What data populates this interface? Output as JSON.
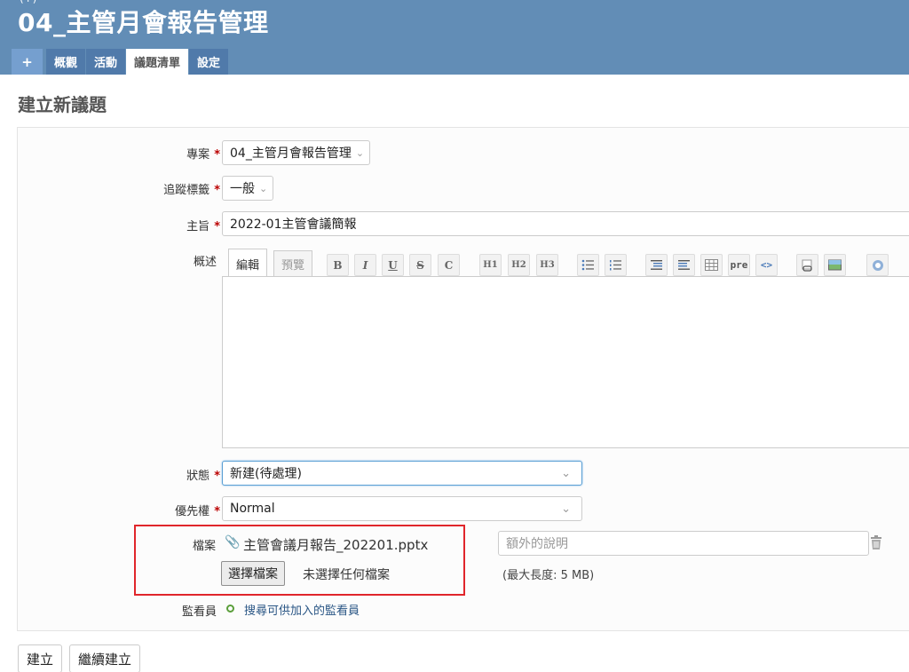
{
  "header": {
    "top_text": "(+)",
    "project_title": "04_主管月會報告管理"
  },
  "menu": {
    "plus": "+",
    "tabs": [
      "概觀",
      "活動",
      "議題清單",
      "設定"
    ],
    "selected": "議題清單"
  },
  "page": {
    "heading": "建立新議題"
  },
  "form": {
    "project": {
      "label": "專案",
      "value": "04_主管月會報告管理"
    },
    "tracker": {
      "label": "追蹤標籤",
      "value": "一般"
    },
    "subject": {
      "label": "主旨",
      "value": "2022-01主管會議簡報"
    },
    "description": {
      "label": "概述",
      "tab_edit": "編輯",
      "tab_preview": "預覽",
      "toolbar": [
        "B",
        "I",
        "U",
        "S",
        "C",
        "H1",
        "H2",
        "H3",
        "ul",
        "ol",
        "blockquote",
        "unquote",
        "table",
        "pre",
        "code",
        "link",
        "image",
        "help"
      ],
      "pre_label": "pre",
      "code_label": "<>"
    },
    "status": {
      "label": "狀態",
      "value": "新建(待處理)"
    },
    "priority": {
      "label": "優先權",
      "value": "Normal"
    },
    "files": {
      "label": "檔案",
      "attached_file": "主管會議月報告_202201.pptx",
      "description_placeholder": "額外的說明",
      "choose_button": "選擇檔案",
      "no_file": "未選擇任何檔案",
      "max_size": "(最大長度: 5 MB)"
    },
    "watchers": {
      "label": "監看員",
      "link": "搜尋可供加入的監看員"
    },
    "required_mark": "*"
  },
  "actions": {
    "create": "建立",
    "create_continue": "繼續建立"
  },
  "colors": {
    "header_bg": "#628db6",
    "tab_bg": "#507aaa",
    "required": "#bb0000",
    "highlight": "#e0262b",
    "link": "#2a5685"
  }
}
